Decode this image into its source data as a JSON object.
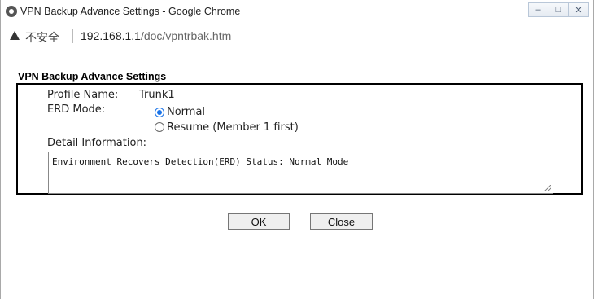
{
  "window": {
    "title": "VPN Backup Advance Settings - Google Chrome"
  },
  "address_bar": {
    "security_label": "不安全",
    "url_host": "192.168.1.1",
    "url_path": "/doc/vpntrbak.htm"
  },
  "page": {
    "heading": "VPN Backup Advance Settings",
    "profile_name_label": "Profile Name:",
    "profile_name_value": "Trunk1",
    "erd_mode_label": "ERD Mode:",
    "erd_mode_options": [
      {
        "label": "Normal",
        "selected": true
      },
      {
        "label": "Resume (Member 1 first)",
        "selected": false
      }
    ],
    "detail_label": "Detail Information:",
    "detail_text": "Environment Recovers Detection(ERD) Status: Normal Mode"
  },
  "buttons": {
    "ok": "OK",
    "close": "Close"
  },
  "icons": {
    "browser": "chrome-icon",
    "warning": "warning-icon",
    "minimize": "minimize-icon",
    "maximize": "maximize-icon",
    "close": "close-icon"
  },
  "colors": {
    "radio_accent": "#1a73e8"
  }
}
